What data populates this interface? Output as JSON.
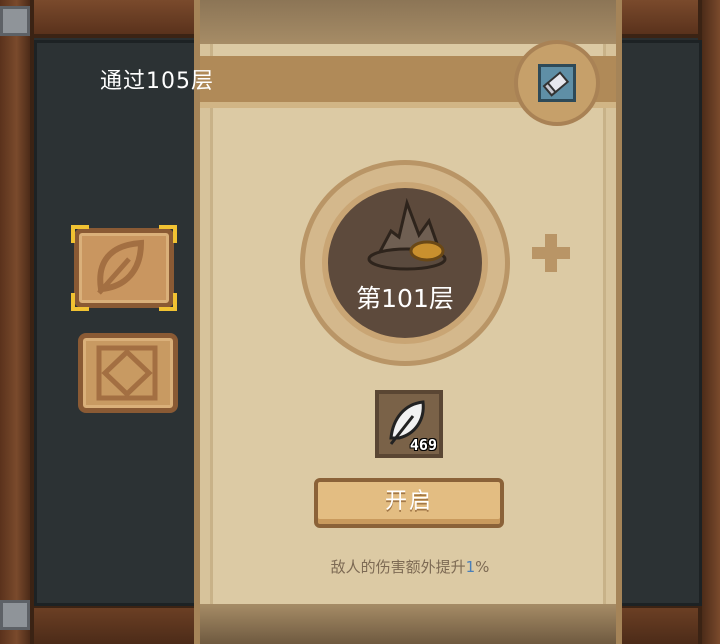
{
  "panel": {
    "title": "通过105层",
    "floor_label": "第101层",
    "item_count": "469",
    "open_button": "开启",
    "bonus_prefix": "敌人的伤害额外提升",
    "bonus_value": "1",
    "bonus_suffix": "%"
  },
  "icons": {
    "note": "scroll-note-icon",
    "medallion": "rock-nest-icon",
    "plus": "plus-icon",
    "item": "feather-icon",
    "tab_leaf": "leaf-icon",
    "tab_diamond": "diamond-icon"
  },
  "colors": {
    "accent_gold": "#f1c232",
    "parchment": "#dccaa4",
    "frame_wood": "#7a4a2c",
    "percent_blue": "#4a7fb8"
  }
}
